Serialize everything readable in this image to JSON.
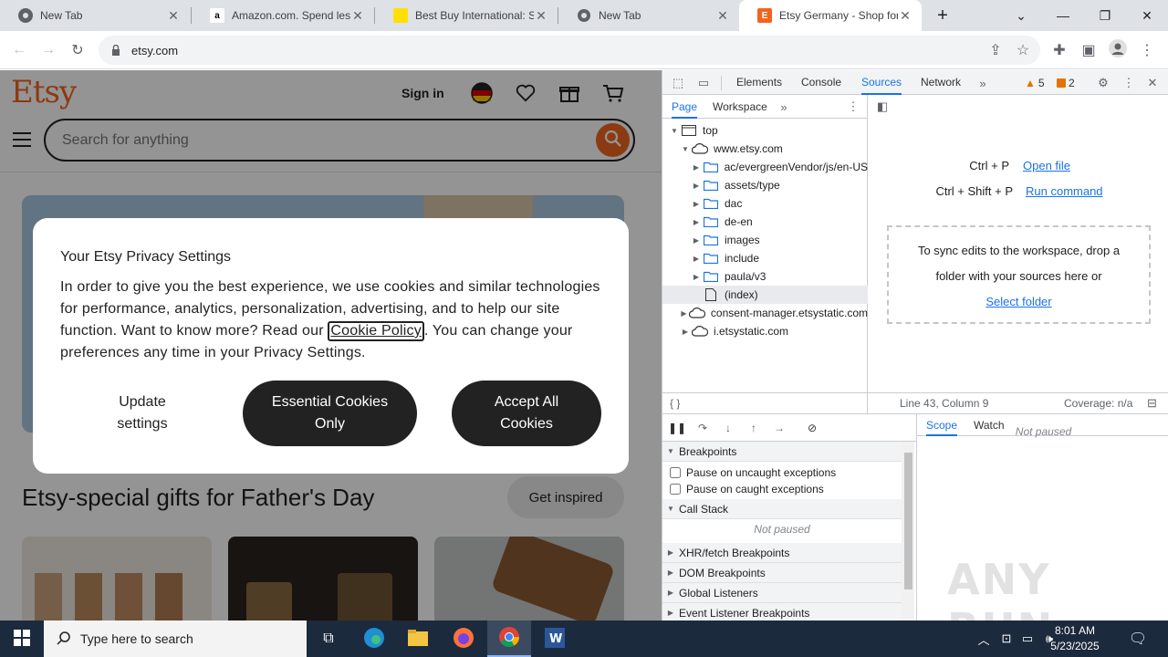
{
  "browser": {
    "tabs": [
      {
        "title": "New Tab",
        "favicon": "chrome-icon",
        "active": false
      },
      {
        "title": "Amazon.com. Spend less.",
        "favicon": "amazon-icon",
        "active": false
      },
      {
        "title": "Best Buy International: Se",
        "favicon": "bestbuy-icon",
        "active": false
      },
      {
        "title": "New Tab",
        "favicon": "chrome-icon",
        "active": false
      },
      {
        "title": "Etsy Germany - Shop for",
        "favicon": "etsy-icon",
        "active": true
      }
    ],
    "new_tab_symbol": "+",
    "url": "etsy.com"
  },
  "etsy": {
    "logo": "Etsy",
    "sign_in": "Sign in",
    "search_placeholder": "Search for anything",
    "section_heading": "Etsy-special gifts for Father's Day",
    "get_inspired": "Get inspired",
    "brand_color": "#f1641e"
  },
  "privacy_modal": {
    "title": "Your Etsy Privacy Settings",
    "body_before_link": "In order to give you the best experience, we use cookies and similar technologies for performance, analytics, personalization, advertising, and to help our site function. Want to know more? Read our ",
    "link_text": "Cookie Policy",
    "body_after_link": ". You can change your preferences any time in your Privacy Settings.",
    "update_settings": "Update settings",
    "essential_only": "Essential Cookies Only",
    "accept_all": "Accept All Cookies"
  },
  "devtools": {
    "tabs": [
      "Elements",
      "Console",
      "Sources",
      "Network"
    ],
    "selected_tab": "Sources",
    "warnings_count": "5",
    "issues_count": "2",
    "nav_tabs": [
      "Page",
      "Workspace"
    ],
    "tree": [
      {
        "label": "top",
        "type": "frame",
        "level": 0,
        "expanded": true
      },
      {
        "label": "www.etsy.com",
        "type": "cloud",
        "level": 1,
        "expanded": true
      },
      {
        "label": "ac/evergreenVendor/js/en-US",
        "type": "folder",
        "level": 2,
        "expanded": false
      },
      {
        "label": "assets/type",
        "type": "folder",
        "level": 2,
        "expanded": false
      },
      {
        "label": "dac",
        "type": "folder",
        "level": 2,
        "expanded": false
      },
      {
        "label": "de-en",
        "type": "folder",
        "level": 2,
        "expanded": false
      },
      {
        "label": "images",
        "type": "folder",
        "level": 2,
        "expanded": false
      },
      {
        "label": "include",
        "type": "folder",
        "level": 2,
        "expanded": false
      },
      {
        "label": "paula/v3",
        "type": "folder",
        "level": 2,
        "expanded": false
      },
      {
        "label": "(index)",
        "type": "file",
        "level": 2,
        "selected": true
      },
      {
        "label": "consent-manager.etsystatic.com",
        "type": "cloud",
        "level": 1,
        "expanded": false
      },
      {
        "label": "i.etsystatic.com",
        "type": "cloud",
        "level": 1,
        "expanded": false
      }
    ],
    "shortcut_open_keys": "Ctrl + P",
    "shortcut_open_label": "Open file",
    "shortcut_run_keys": "Ctrl + Shift + P",
    "shortcut_run_label": "Run command",
    "workspace_hint": "To sync edits to the workspace, drop a folder with your sources here or",
    "select_folder": "Select folder",
    "cursor_position": "Line 43, Column 9",
    "coverage": "Coverage: n/a",
    "breakpoints_header": "Breakpoints",
    "pause_uncaught": "Pause on uncaught exceptions",
    "pause_caught": "Pause on caught exceptions",
    "call_stack_header": "Call Stack",
    "not_paused": "Not paused",
    "xhr_breakpoints": "XHR/fetch Breakpoints",
    "dom_breakpoints": "DOM Breakpoints",
    "global_listeners": "Global Listeners",
    "event_listener_breakpoints": "Event Listener Breakpoints",
    "scope_tab": "Scope",
    "watch_tab": "Watch",
    "scope_not_paused": "Not paused",
    "accent_color": "#1a73e8"
  },
  "taskbar": {
    "search_placeholder": "Type here to search",
    "time": "8:01 AM",
    "date": "5/23/2025"
  },
  "watermark": "ANY RUN"
}
